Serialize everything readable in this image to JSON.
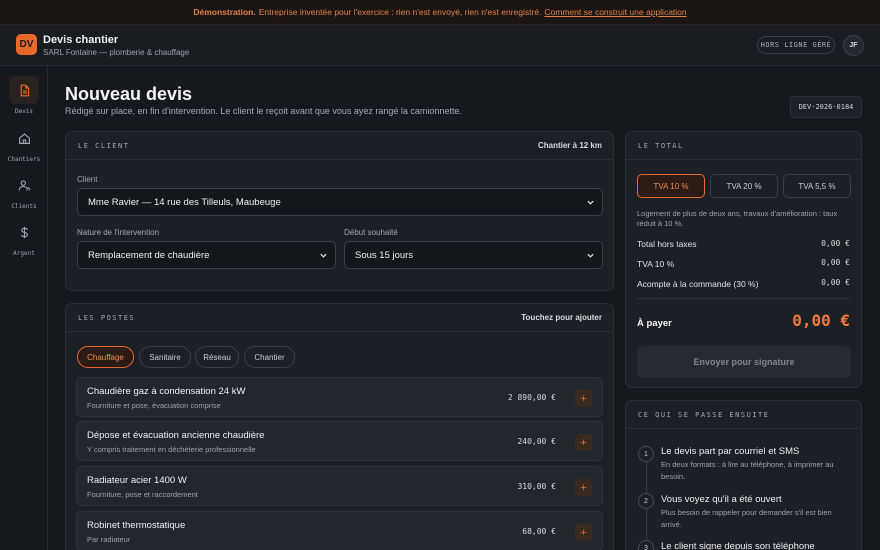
{
  "banner": {
    "lead": "Démonstration.",
    "text": "Entreprise inventée pour l'exercice : rien n'est envoyé, rien n'est enregistré.",
    "link": "Comment se construit une application"
  },
  "app": {
    "logo": "DV",
    "title": "Devis chantier",
    "subtitle": "SARL Fontaine — plomberie & chauffage",
    "status_pill": "HORS LIGNE GÉRÉ",
    "avatar": "JF"
  },
  "sidebar": {
    "items": [
      {
        "label": "Devis",
        "icon": "document-icon",
        "active": true
      },
      {
        "label": "Chantiers",
        "icon": "home-icon",
        "active": false
      },
      {
        "label": "Clients",
        "icon": "users-icon",
        "active": false
      },
      {
        "label": "Argent",
        "icon": "dollar-icon",
        "active": false
      }
    ]
  },
  "page": {
    "title": "Nouveau devis",
    "subtitle": "Rédigé sur place, en fin d'intervention. Le client le reçoit avant que vous ayez rangé la camionnette.",
    "reference": "DEV-2026-0184"
  },
  "client_card": {
    "title": "LE CLIENT",
    "aside": "Chantier à 12 km",
    "client_label": "Client",
    "client_value": "Mme Ravier — 14 rue des Tilleuls, Maubeuge",
    "nature_label": "Nature de l'intervention",
    "nature_value": "Remplacement de chaudière",
    "start_label": "Début souhaité",
    "start_value": "Sous 15 jours"
  },
  "postes_card": {
    "title": "LES POSTES",
    "aside": "Touchez pour ajouter",
    "chips": [
      "Chauffage",
      "Sanitaire",
      "Réseau",
      "Chantier"
    ],
    "active_chip": "Chauffage",
    "items": [
      {
        "name": "Chaudière gaz à condensation 24 kW",
        "desc": "Fourniture et pose, évacuation comprise",
        "price": "2 890,00 €",
        "add": "+"
      },
      {
        "name": "Dépose et évacuation ancienne chaudière",
        "desc": "Y compris traitement en déchèterie professionnelle",
        "price": "240,00 €",
        "add": "+"
      },
      {
        "name": "Radiateur acier 1400 W",
        "desc": "Fourniture, pose et raccordement",
        "price": "310,00 €",
        "add": "+"
      },
      {
        "name": "Robinet thermostatique",
        "desc": "Par radiateur",
        "price": "68,00 €",
        "add": "+"
      }
    ]
  },
  "total_card": {
    "title": "LE TOTAL",
    "tva_options": [
      "TVA 10 %",
      "TVA 20 %",
      "TVA 5,5 %"
    ],
    "active_tva": "TVA 10 %",
    "tva_note": "Logement de plus de deux ans, travaux d'amélioration : taux réduit à 10 %.",
    "rows": [
      {
        "label": "Total hors taxes",
        "value": "0,00 €"
      },
      {
        "label": "TVA 10 %",
        "value": "0,00 €"
      },
      {
        "label": "Acompte à la commande (30 %)",
        "value": "0,00 €"
      }
    ],
    "pay_label": "À payer",
    "pay_value": "0,00 €",
    "sign_button": "Envoyer pour signature"
  },
  "next_card": {
    "title": "CE QUI SE PASSE ENSUITE",
    "steps": [
      {
        "num": "1",
        "title": "Le devis part par courriel et SMS",
        "desc": "En deux formats : à lire au téléphone, à imprimer au besoin."
      },
      {
        "num": "2",
        "title": "Vous voyez qu'il a été ouvert",
        "desc": "Plus besoin de rappeler pour demander s'il est bien arrivé."
      },
      {
        "num": "3",
        "title": "Le client signe depuis son téléphone",
        "desc": ""
      }
    ]
  },
  "colors": {
    "accent": "#e9692c",
    "background": "#15181d",
    "card": "#1c1f25",
    "banner_text": "#e0824a"
  }
}
